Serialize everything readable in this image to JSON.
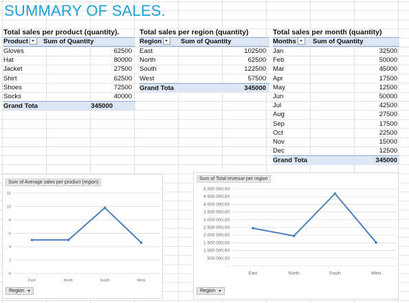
{
  "sheet": {
    "title": "SUMMARY OF SALES."
  },
  "pivot_product": {
    "title": "Total sales per product (quantity).",
    "row_header": "Product",
    "value_header": "Sum of Quantity",
    "rows": [
      {
        "label": "Gloves",
        "value": "62500"
      },
      {
        "label": "Hat",
        "value": "80000"
      },
      {
        "label": "Jacket",
        "value": "27500"
      },
      {
        "label": "Shirt",
        "value": "62500"
      },
      {
        "label": "Shoes",
        "value": "72500"
      },
      {
        "label": "Socks",
        "value": "40000"
      }
    ],
    "total_label": "Grand Tota",
    "total_value": "345000"
  },
  "pivot_region": {
    "title": "Total sales per region (quantity)",
    "row_header": "Region",
    "value_header": "Sum of Quantity",
    "rows": [
      {
        "label": "East",
        "value": "102500"
      },
      {
        "label": "North",
        "value": "62500"
      },
      {
        "label": "South",
        "value": "122500"
      },
      {
        "label": "West",
        "value": "57500"
      }
    ],
    "total_label": "Grand Tota",
    "total_value": "345000"
  },
  "pivot_month": {
    "title": "Total sales per month (quantity)",
    "row_header": "Months",
    "value_header": "Sum of Quantity",
    "rows": [
      {
        "label": "Jan",
        "value": "32500"
      },
      {
        "label": "Feb",
        "value": "50000"
      },
      {
        "label": "Mar",
        "value": "45000"
      },
      {
        "label": "Apr",
        "value": "17500"
      },
      {
        "label": "May",
        "value": "12500"
      },
      {
        "label": "Jun",
        "value": "50000"
      },
      {
        "label": "Jul",
        "value": "42500"
      },
      {
        "label": "Aug",
        "value": "27500"
      },
      {
        "label": "Sep",
        "value": "17500"
      },
      {
        "label": "Oct",
        "value": "22500"
      },
      {
        "label": "Nov",
        "value": "15000"
      },
      {
        "label": "Dec",
        "value": "12500"
      }
    ],
    "total_label": "Grand Tota",
    "total_value": "345000"
  },
  "colors": {
    "title": "#1e9fd8",
    "header_fill": "#dde6f3",
    "series_line": "#4a7ebb"
  },
  "chart_data": [
    {
      "type": "line",
      "title": "Sum of Average sales per product (region)",
      "filter_button": "Region",
      "categories": [
        "East",
        "North",
        "South",
        "West"
      ],
      "values": [
        5,
        5,
        9.8,
        4.6
      ],
      "y_ticks": [
        "0",
        "2",
        "4",
        "6",
        "8",
        "10",
        "12"
      ],
      "ylim": [
        0,
        12
      ],
      "grid": true
    },
    {
      "type": "line",
      "title": "Sum of Total revenue per region",
      "filter_button": "Region",
      "categories": [
        "East",
        "North",
        "South",
        "West"
      ],
      "values": [
        2450000,
        1950000,
        4700000,
        1520000
      ],
      "y_ticks": [
        "-",
        "500 000,00",
        "1 000 000,00",
        "1 500 000,00",
        "2 000 000,00",
        "2 500 000,00",
        "3 000 000,00",
        "3 500 000,00",
        "4 000 000,00",
        "4 500 000,00",
        "5 000 000,00"
      ],
      "ylim": [
        0,
        5000000
      ],
      "grid": true
    }
  ]
}
